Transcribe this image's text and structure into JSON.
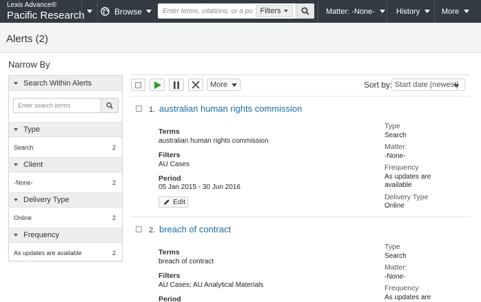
{
  "topbar": {
    "brand_sub": "Lexis Advance®",
    "brand_main": "Pacific Research",
    "browse_label": "Browse",
    "search_placeholder": "Enter terms, citations, or a publ",
    "filters_label": "Filters",
    "matter_label": "Matter: -None-",
    "history_label": "History",
    "more_label": "More",
    "icons": [
      "chevron-down-icon",
      "globe-icon",
      "search-icon"
    ]
  },
  "page": {
    "title": "Alerts (2)"
  },
  "sidebar": {
    "title": "Narrow By",
    "search_heading": "Search Within Alerts",
    "search_placeholder": "Enter search terms",
    "facets": [
      {
        "heading": "Type",
        "items": [
          {
            "label": "Search",
            "count": "2"
          }
        ]
      },
      {
        "heading": "Client",
        "items": [
          {
            "label": "-None-",
            "count": "2"
          }
        ]
      },
      {
        "heading": "Delivery Type",
        "items": [
          {
            "label": "Online",
            "count": "2"
          }
        ]
      },
      {
        "heading": "Frequency",
        "items": [
          {
            "label": "As updates are available",
            "count": "2"
          }
        ]
      }
    ]
  },
  "toolbar": {
    "more_label": "More",
    "sort_label": "Sort by:",
    "sort_value": "Start date (newest)",
    "icons": [
      "checkbox-icon",
      "play-icon",
      "pause-icon",
      "close-icon"
    ],
    "play_color": "#2c9c2c"
  },
  "results": [
    {
      "number": "1.",
      "title": "australian human rights commission",
      "terms_label": "Terms",
      "terms": "australian human rights commission",
      "filters_label": "Filters",
      "filters": "AU Cases",
      "period_label": "Period",
      "period": "05 Jan 2015 - 30 Jun 2016",
      "edit_label": "Edit",
      "type_label": "Type",
      "type": "Search",
      "matter_label": "Matter:",
      "matter": "-None-",
      "frequency_label": "Frequency",
      "frequency_line1": "As updates are",
      "frequency_line2": "available",
      "delivery_label": "Delivery Type",
      "delivery": "Online"
    },
    {
      "number": "2.",
      "title": "breach of contract",
      "terms_label": "Terms",
      "terms": "breach of contract",
      "filters_label": "Filters",
      "filters": "AU Cases; AU Analytical Materials",
      "period_label": "Period",
      "type_label": "Type",
      "type": "Search",
      "matter_label": "Matter:",
      "matter": "-None-",
      "frequency_label": "Frequency",
      "frequency_line1": "As updates are"
    }
  ],
  "colors": {
    "topbar_bg": "#333a42",
    "link": "#1a6aa6"
  }
}
